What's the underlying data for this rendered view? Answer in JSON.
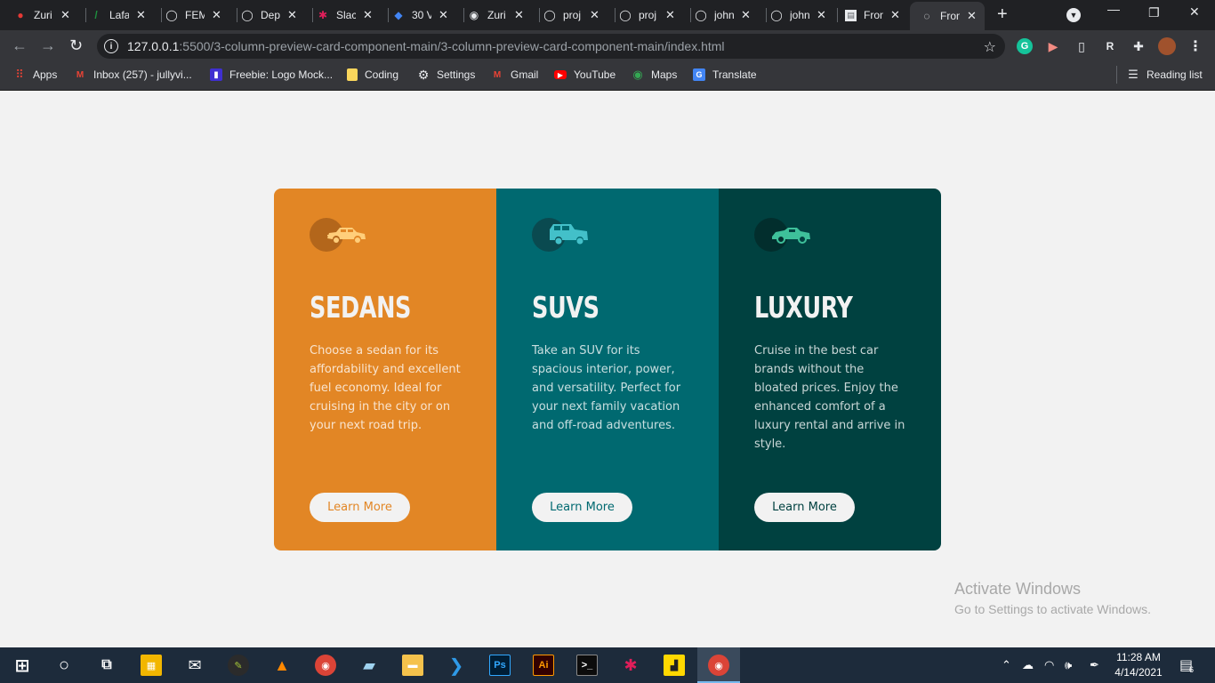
{
  "browser": {
    "tabs": [
      {
        "title": "Zuri",
        "icon": "red-dot-icon",
        "color": "#e53935"
      },
      {
        "title": "Lafa",
        "icon": "lafa-icon",
        "color": "#1e8e3e"
      },
      {
        "title": "FEM",
        "icon": "github-icon",
        "color": "#e8eaed"
      },
      {
        "title": "Dep",
        "icon": "github-icon",
        "color": "#e8eaed"
      },
      {
        "title": "Slac",
        "icon": "slack-icon",
        "color": "#e8eaed"
      },
      {
        "title": "30 V",
        "icon": "diamond-icon",
        "color": "#4285f4"
      },
      {
        "title": "Zuri",
        "icon": "globe-icon",
        "color": "#e8eaed"
      },
      {
        "title": "proj",
        "icon": "github-icon",
        "color": "#e8eaed"
      },
      {
        "title": "proj",
        "icon": "github-icon",
        "color": "#e8eaed"
      },
      {
        "title": "john",
        "icon": "github-icon",
        "color": "#e8eaed"
      },
      {
        "title": "john",
        "icon": "github-icon",
        "color": "#e8eaed"
      },
      {
        "title": "Fron",
        "icon": "page-icon",
        "color": "#e8eaed"
      },
      {
        "title": "Fron",
        "icon": "loading-icon",
        "color": "#e8eaed"
      }
    ],
    "active_tab_index": 12,
    "url_host": "127.0.0.1",
    "url_rest": ":5500/3-column-preview-card-component-main/3-column-preview-card-component-main/index.html",
    "bookmarks": [
      {
        "label": "Apps",
        "icon": "apps-grid-icon"
      },
      {
        "label": "Inbox (257) - jullyvi...",
        "icon": "gmail-icon"
      },
      {
        "label": "Freebie: Logo Mock...",
        "icon": "freebie-icon"
      },
      {
        "label": "Coding",
        "icon": "folder-icon"
      },
      {
        "label": "Settings",
        "icon": "gear-icon"
      },
      {
        "label": "Gmail",
        "icon": "gmail-icon"
      },
      {
        "label": "YouTube",
        "icon": "youtube-icon"
      },
      {
        "label": "Maps",
        "icon": "maps-icon"
      },
      {
        "label": "Translate",
        "icon": "translate-icon"
      }
    ],
    "reading_list": "Reading list"
  },
  "page": {
    "cards": [
      {
        "id": "sedans",
        "title": "Sedans",
        "text": "Choose a sedan for its affordability and excellent fuel economy. Ideal for cruising in the city or on your next road trip.",
        "button": "Learn More",
        "bg": "#e28625",
        "accent": "#ffce7a"
      },
      {
        "id": "suvs",
        "title": "SUVs",
        "text": "Take an SUV for its spacious interior, power, and versatility. Perfect for your next family vacation and off-road adventures.",
        "button": "Learn More",
        "bg": "#006970",
        "accent": "#43c0c9"
      },
      {
        "id": "luxury",
        "title": "Luxury",
        "text": "Cruise in the best car brands without the bloated prices. Enjoy the enhanced comfort of a luxury rental and arrive in style.",
        "button": "Learn More",
        "bg": "#004140",
        "accent": "#3ec09a"
      }
    ]
  },
  "watermark": {
    "line1": "Activate Windows",
    "line2": "Go to Settings to activate Windows."
  },
  "taskbar": {
    "time": "11:28 AM",
    "date": "4/14/2021",
    "notification_count": "6"
  }
}
